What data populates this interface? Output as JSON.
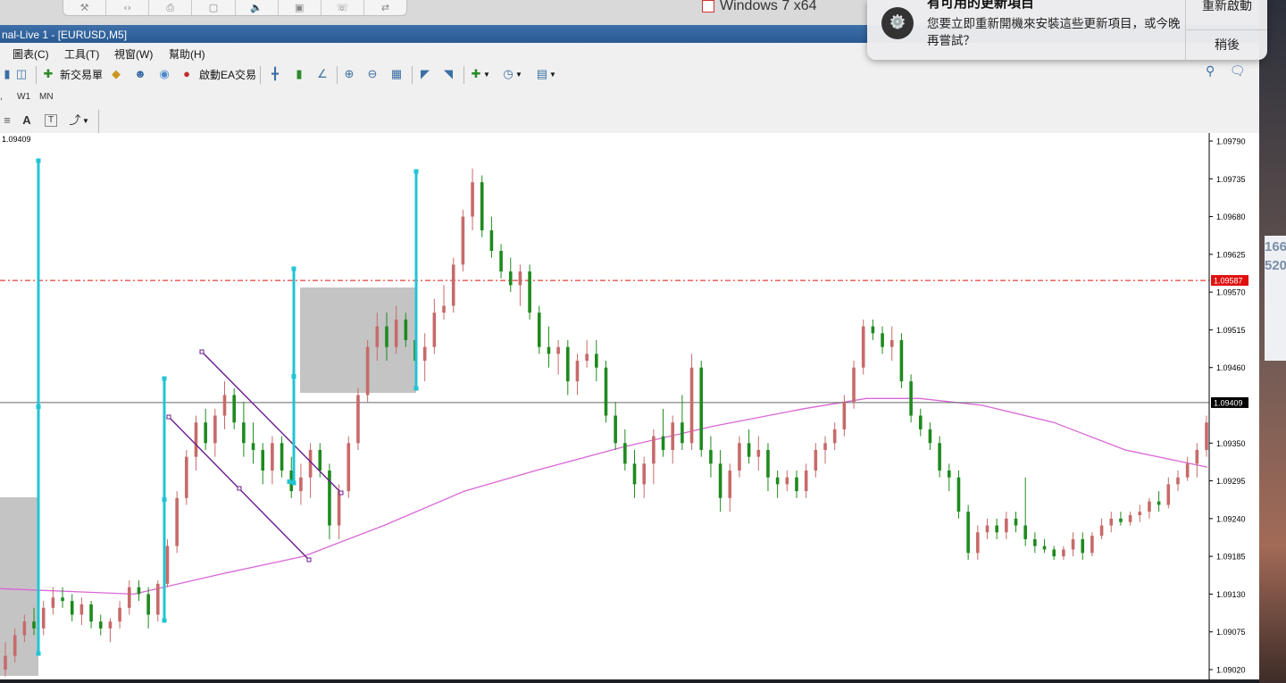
{
  "host": {
    "vm_tab_label": "Windows 7 x64"
  },
  "window": {
    "title": "nal-Live 1 - [EURUSD,M5]"
  },
  "menu": [
    "圖表(C)",
    "工具(T)",
    "視窗(W)",
    "幫助(H)"
  ],
  "toolbar": {
    "new_order_label": "新交易單",
    "autotrade_label": "啟動EA交易"
  },
  "timeframes": [
    "W1",
    "MN"
  ],
  "drawing_tools": {
    "text_label": "A",
    "textbox_label": "T"
  },
  "notification": {
    "title": "有可用的更新項目",
    "body": "您要立即重新開機來安裝這些更新項目，或今晚再嘗試？",
    "restart_label": "重新啟動",
    "later_label": "稍後"
  },
  "desktop_partial": [
    "166",
    "520"
  ],
  "chart_data": {
    "type": "candlestick",
    "symbol": "EURUSD",
    "timeframe": "M5",
    "price_readout": "1.09409",
    "ylim": [
      1.09,
      1.0981
    ],
    "y_ticks": [
      "1.09790",
      "1.09735",
      "1.09680",
      "1.09625",
      "1.09570",
      "1.09515",
      "1.09460",
      "1.09350",
      "1.09295",
      "1.09240",
      "1.09185",
      "1.09130",
      "1.09075",
      "1.09020"
    ],
    "levels": {
      "ask": {
        "value": 1.09587,
        "label": "1.09587",
        "color": "#e01010"
      },
      "crosshair": {
        "value": 1.09409,
        "label": "1.09409",
        "color": "#000000"
      }
    },
    "colors": {
      "bull": "#c76a6a",
      "bear": "#1e8a1e",
      "moving_average": "#d966d6",
      "trendline": "#6a1b8a",
      "marker": "#22c4d4",
      "zone": "#9a9a9a"
    },
    "candles_ohlc_shape": [
      [
        1.0902,
        1.0901,
        1.0906,
        1.0904
      ],
      [
        1.0904,
        1.0903,
        1.0908,
        1.0907
      ],
      [
        1.0907,
        1.0906,
        1.091,
        1.0909
      ],
      [
        1.0909,
        1.0907,
        1.0911,
        1.0908
      ],
      [
        1.0908,
        1.0907,
        1.0912,
        1.0911
      ],
      [
        1.0911,
        1.091,
        1.0914,
        1.09125
      ],
      [
        1.09125,
        1.0911,
        1.0914,
        1.0912
      ],
      [
        1.0912,
        1.0909,
        1.0913,
        1.091
      ],
      [
        1.091,
        1.09085,
        1.09125,
        1.09115
      ],
      [
        1.09115,
        1.0908,
        1.0912,
        1.0909
      ],
      [
        1.0909,
        1.0907,
        1.091,
        1.0908
      ],
      [
        1.0908,
        1.0906,
        1.09095,
        1.0909
      ],
      [
        1.0909,
        1.0908,
        1.0912,
        1.0911
      ],
      [
        1.0911,
        1.091,
        1.0915,
        1.0914
      ],
      [
        1.0914,
        1.0912,
        1.0915,
        1.0913
      ],
      [
        1.0913,
        1.0908,
        1.0914,
        1.091
      ],
      [
        1.091,
        1.0909,
        1.0915,
        1.09145
      ],
      [
        1.09145,
        1.0914,
        1.0921,
        1.092
      ],
      [
        1.092,
        1.0919,
        1.0928,
        1.0927
      ],
      [
        1.0927,
        1.0926,
        1.0934,
        1.0933
      ],
      [
        1.0933,
        1.0931,
        1.0939,
        1.0938
      ],
      [
        1.0938,
        1.0934,
        1.094,
        1.0935
      ],
      [
        1.0935,
        1.0933,
        1.094,
        1.0939
      ],
      [
        1.0939,
        1.0937,
        1.0944,
        1.0942
      ],
      [
        1.0942,
        1.0937,
        1.0943,
        1.0938
      ],
      [
        1.0938,
        1.0933,
        1.0941,
        1.0935
      ],
      [
        1.0935,
        1.0932,
        1.0938,
        1.0934
      ],
      [
        1.0934,
        1.0929,
        1.0935,
        1.0931
      ],
      [
        1.0931,
        1.0929,
        1.0936,
        1.0935
      ],
      [
        1.0935,
        1.093,
        1.0936,
        1.0931
      ],
      [
        1.0931,
        1.0927,
        1.0933,
        1.0928
      ],
      [
        1.0928,
        1.0926,
        1.0932,
        1.093
      ],
      [
        1.093,
        1.0927,
        1.0935,
        1.0934
      ],
      [
        1.0934,
        1.093,
        1.0935,
        1.0931
      ],
      [
        1.0931,
        1.0921,
        1.0932,
        1.0923
      ],
      [
        1.0923,
        1.0921,
        1.0929,
        1.0928
      ],
      [
        1.0928,
        1.0927,
        1.0936,
        1.0935
      ],
      [
        1.0935,
        1.0934,
        1.0943,
        1.0942
      ],
      [
        1.0942,
        1.0941,
        1.095,
        1.0949
      ],
      [
        1.0949,
        1.0947,
        1.0954,
        1.0952
      ],
      [
        1.0952,
        1.0947,
        1.0954,
        1.0949
      ],
      [
        1.0949,
        1.0948,
        1.0955,
        1.0953
      ],
      [
        1.0953,
        1.0949,
        1.0954,
        1.095
      ],
      [
        1.095,
        1.0946,
        1.0952,
        1.0947
      ],
      [
        1.0947,
        1.0944,
        1.0951,
        1.0949
      ],
      [
        1.0949,
        1.0948,
        1.0956,
        1.0954
      ],
      [
        1.0954,
        1.0953,
        1.0958,
        1.0955
      ],
      [
        1.0955,
        1.0954,
        1.0962,
        1.0961
      ],
      [
        1.0961,
        1.096,
        1.0969,
        1.0968
      ],
      [
        1.0968,
        1.0966,
        1.0975,
        1.0973
      ],
      [
        1.0973,
        1.0965,
        1.0974,
        1.0966
      ],
      [
        1.0966,
        1.0962,
        1.0968,
        1.0963
      ],
      [
        1.0963,
        1.0959,
        1.0964,
        1.096
      ],
      [
        1.096,
        1.0957,
        1.0962,
        1.0958
      ],
      [
        1.0958,
        1.0955,
        1.0961,
        1.096
      ],
      [
        1.096,
        1.0953,
        1.0961,
        1.0954
      ],
      [
        1.0954,
        1.0948,
        1.0955,
        1.0949
      ],
      [
        1.0949,
        1.0946,
        1.0952,
        1.0948
      ],
      [
        1.0948,
        1.0945,
        1.095,
        1.0949
      ],
      [
        1.0949,
        1.0942,
        1.095,
        1.0944
      ],
      [
        1.0944,
        1.0942,
        1.0948,
        1.0947
      ],
      [
        1.0947,
        1.0946,
        1.095,
        1.0948
      ],
      [
        1.0948,
        1.0944,
        1.095,
        1.0946
      ],
      [
        1.0946,
        1.0938,
        1.0947,
        1.0939
      ],
      [
        1.0939,
        1.0934,
        1.0941,
        1.0935
      ],
      [
        1.0935,
        1.0931,
        1.0937,
        1.0932
      ],
      [
        1.0932,
        1.0927,
        1.0934,
        1.0929
      ],
      [
        1.0929,
        1.0927,
        1.0933,
        1.0932
      ],
      [
        1.0932,
        1.0929,
        1.0937,
        1.0936
      ],
      [
        1.0936,
        1.0933,
        1.094,
        1.0934
      ],
      [
        1.0934,
        1.0932,
        1.0939,
        1.0938
      ],
      [
        1.0938,
        1.0934,
        1.0942,
        1.0935
      ],
      [
        1.0935,
        1.0934,
        1.0948,
        1.0946
      ],
      [
        1.0946,
        1.0933,
        1.0947,
        1.0934
      ],
      [
        1.0934,
        1.093,
        1.0936,
        1.0932
      ],
      [
        1.0932,
        1.0925,
        1.0934,
        1.0927
      ],
      [
        1.0927,
        1.0925,
        1.0932,
        1.0931
      ],
      [
        1.0931,
        1.093,
        1.0936,
        1.0935
      ],
      [
        1.0935,
        1.0932,
        1.0937,
        1.0933
      ],
      [
        1.0933,
        1.0931,
        1.0936,
        1.0934
      ],
      [
        1.0934,
        1.0928,
        1.0935,
        1.093
      ],
      [
        1.093,
        1.0927,
        1.0931,
        1.0929
      ],
      [
        1.0929,
        1.0928,
        1.0931,
        1.093
      ],
      [
        1.093,
        1.0927,
        1.0931,
        1.0928
      ],
      [
        1.0928,
        1.0927,
        1.0932,
        1.0931
      ],
      [
        1.0931,
        1.093,
        1.0935,
        1.0934
      ],
      [
        1.0934,
        1.0932,
        1.0936,
        1.0935
      ],
      [
        1.0935,
        1.0934,
        1.0938,
        1.0937
      ],
      [
        1.0937,
        1.0936,
        1.0942,
        1.0941
      ],
      [
        1.0941,
        1.094,
        1.0947,
        1.0946
      ],
      [
        1.0946,
        1.0945,
        1.0953,
        1.0952
      ],
      [
        1.0952,
        1.095,
        1.0953,
        1.0951
      ],
      [
        1.0951,
        1.0948,
        1.0952,
        1.0949
      ],
      [
        1.0949,
        1.0947,
        1.0952,
        1.095
      ],
      [
        1.095,
        1.0943,
        1.0951,
        1.0944
      ],
      [
        1.0944,
        1.0938,
        1.0945,
        1.0939
      ],
      [
        1.0939,
        1.0936,
        1.094,
        1.0937
      ],
      [
        1.0937,
        1.0934,
        1.0938,
        1.0935
      ],
      [
        1.0935,
        1.093,
        1.0936,
        1.0931
      ],
      [
        1.0931,
        1.0928,
        1.0932,
        1.093
      ],
      [
        1.093,
        1.0924,
        1.0931,
        1.0925
      ],
      [
        1.0925,
        1.0918,
        1.0926,
        1.0919
      ],
      [
        1.0919,
        1.0918,
        1.0923,
        1.0922
      ],
      [
        1.0922,
        1.0921,
        1.0924,
        1.0923
      ],
      [
        1.0923,
        1.0921,
        1.0924,
        1.0922
      ],
      [
        1.0922,
        1.0921,
        1.0925,
        1.0924
      ],
      [
        1.0924,
        1.0922,
        1.0925,
        1.0923
      ],
      [
        1.0923,
        1.092,
        1.093,
        1.0921
      ],
      [
        1.0921,
        1.0919,
        1.0922,
        1.092
      ],
      [
        1.092,
        1.0919,
        1.0921,
        1.09195
      ],
      [
        1.09195,
        1.0918,
        1.092,
        1.09185
      ],
      [
        1.09185,
        1.0918,
        1.092,
        1.09195
      ],
      [
        1.09195,
        1.09185,
        1.0922,
        1.0921
      ],
      [
        1.0921,
        1.0918,
        1.0922,
        1.0919
      ],
      [
        1.0919,
        1.09185,
        1.0922,
        1.09215
      ],
      [
        1.09215,
        1.0921,
        1.0924,
        1.0923
      ],
      [
        1.0923,
        1.0922,
        1.0925,
        1.0924
      ],
      [
        1.0924,
        1.0923,
        1.0925,
        1.09235
      ],
      [
        1.09235,
        1.0923,
        1.0925,
        1.09245
      ],
      [
        1.09245,
        1.09235,
        1.0926,
        1.0925
      ],
      [
        1.0925,
        1.0924,
        1.0927,
        1.09265
      ],
      [
        1.09265,
        1.0925,
        1.0928,
        1.0926
      ],
      [
        1.0926,
        1.09255,
        1.093,
        1.0929
      ],
      [
        1.0929,
        1.0928,
        1.0931,
        1.093
      ],
      [
        1.093,
        1.09295,
        1.0933,
        1.0932
      ],
      [
        1.0932,
        1.093,
        1.0935,
        1.0934
      ],
      [
        1.0934,
        1.0933,
        1.0939,
        1.0938
      ]
    ]
  }
}
